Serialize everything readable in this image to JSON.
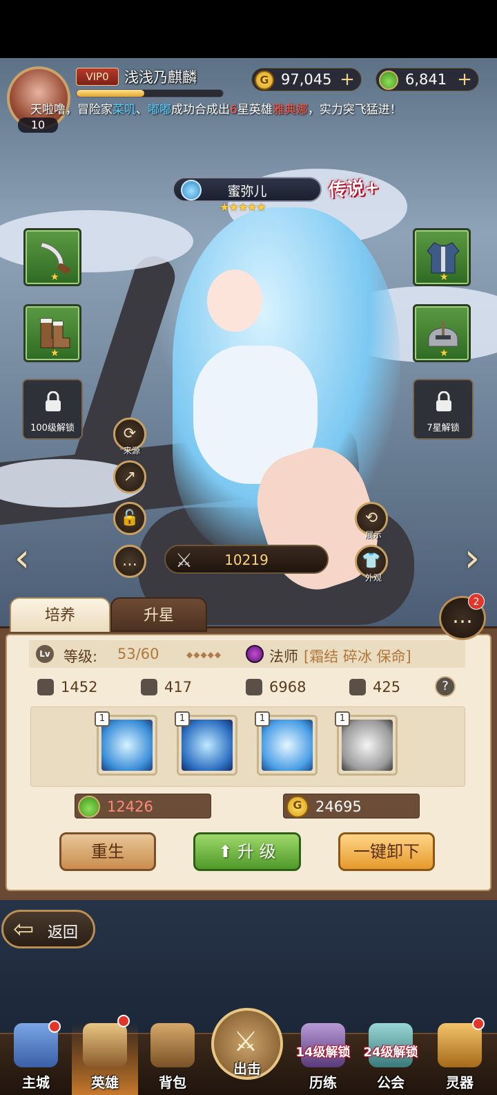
{
  "player": {
    "level": "10",
    "vip": "VIP0",
    "name": "浅浅乃麒麟",
    "xp_fraction": 0.46
  },
  "currency": {
    "gold": "97,045",
    "potion": "6,841",
    "coin_glyph": "G"
  },
  "ticker": {
    "prefix": "天啦噜，冒险家",
    "name1": "菜叽",
    "sep": "、",
    "name2": "嘟嘟",
    "mid": "成功合成出",
    "star": "6",
    "mid2": "星英雄",
    "hero": "雅典娜",
    "suffix": "，实力突飞猛进！"
  },
  "hero": {
    "name": "蜜弥儿",
    "stars": "★★★★★",
    "rarity": "传说+",
    "power": "10219"
  },
  "equipment": {
    "left": [
      {
        "name": "scimitar",
        "star": "★"
      },
      {
        "name": "boots",
        "star": "★"
      }
    ],
    "right": [
      {
        "name": "vest",
        "star": "★"
      },
      {
        "name": "helmet",
        "star": "★"
      }
    ],
    "locked_left": "100级解锁",
    "locked_right": "7星解锁"
  },
  "side_buttons": {
    "source": "来源",
    "display": "展示",
    "appearance": "外观"
  },
  "tabs": {
    "train": "培养",
    "star_up": "升星"
  },
  "chat_badge": "2",
  "stats": {
    "lv_icon": "Lv",
    "level_label": "等级:",
    "level_value": "53/60",
    "diamonds": "◆◆◆◆◆",
    "class_label": "法师",
    "class_tags": "[霜结 碎冰 保命]",
    "attack": "1452",
    "defense": "417",
    "hp": "6968",
    "speed": "425",
    "help": "?"
  },
  "skills": [
    {
      "level": "1"
    },
    {
      "level": "1"
    },
    {
      "level": "1"
    },
    {
      "level": "1"
    }
  ],
  "costs": {
    "potion": "12426",
    "gold": "24695"
  },
  "buttons": {
    "rebirth": "重生",
    "upgrade": "升 级",
    "unequip_all": "一键卸下",
    "back": "返回"
  },
  "nav": {
    "main_city": "主城",
    "heroes": "英雄",
    "backpack": "背包",
    "attack_label": "出击",
    "training": "历练",
    "training_lock": "14级解锁",
    "guild": "公会",
    "guild_lock": "24级解锁",
    "artifact": "灵器"
  },
  "colors": {
    "accent_gold": "#ffd27a",
    "upgrade_green": "#4f9a2a",
    "badge_red": "#e2362b"
  }
}
